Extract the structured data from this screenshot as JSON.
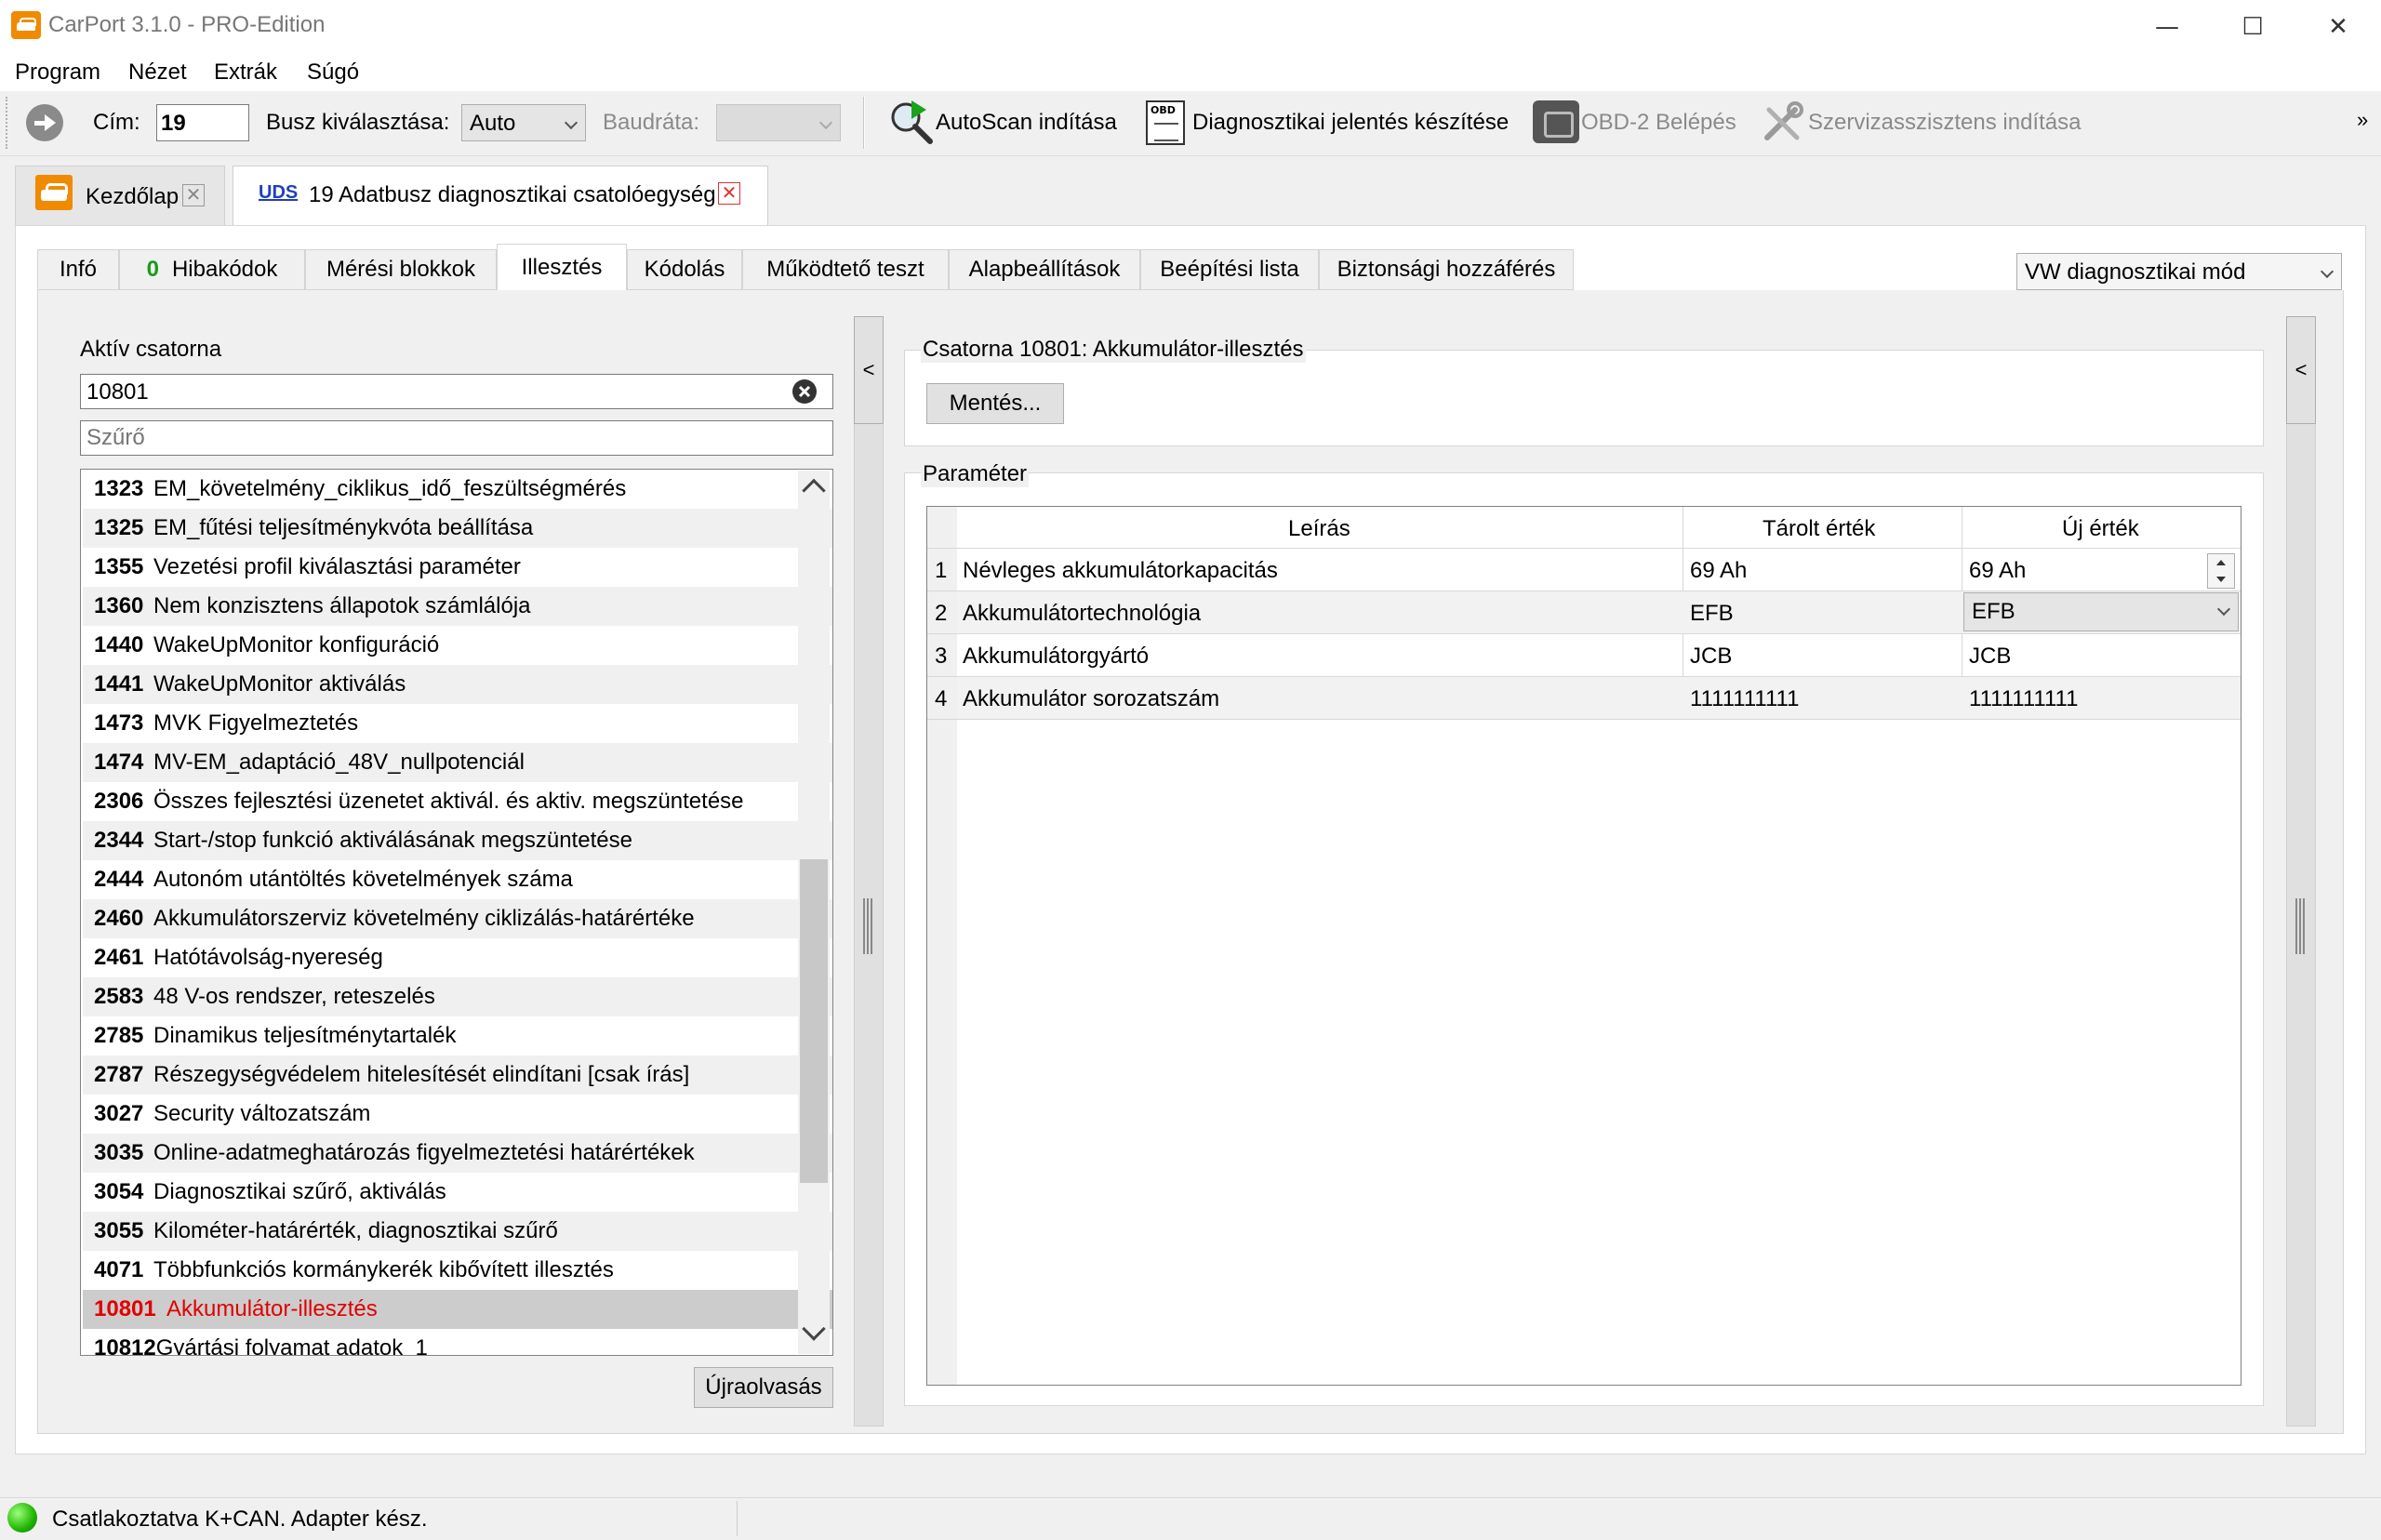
{
  "window": {
    "title": "CarPort 3.1.0 - PRO-Edition",
    "controls": [
      "—",
      "☐",
      "✕"
    ]
  },
  "menu": [
    "Program",
    "Nézet",
    "Extrák",
    "Súgó"
  ],
  "toolbar": {
    "address_label": "Cím:",
    "address_value": "19",
    "bus_label": "Busz kiválasztása:",
    "bus_value": "Auto",
    "baud_label": "Baudráta:",
    "baud_value": "",
    "autoscan": "AutoScan indítása",
    "report": "Diagnosztikai jelentés készítése",
    "obd": "OBD-2 Belépés",
    "service": "Szervizasszisztens indítása",
    "overflow": "»"
  },
  "doc_tabs": {
    "home": "Kezdőlap",
    "uds_badge": "UDS",
    "module": "19 Adatbusz diagnosztikai csatolóegység",
    "close": "✕"
  },
  "sub_tabs": {
    "info": "Infó",
    "fault_count": "0",
    "faults": "Hibakódok",
    "meas": "Mérési blokkok",
    "adapt": "Illesztés",
    "coding": "Kódolás",
    "actuator": "Működtető teszt",
    "basic": "Alapbeállítások",
    "install": "Beépítési lista",
    "security": "Biztonsági hozzáférés"
  },
  "mode_select": "VW diagnosztikai mód",
  "left": {
    "active_label": "Aktív csatorna",
    "channel_value": "10801",
    "filter_placeholder": "Szűrő",
    "reload": "Újraolvasás",
    "channels": [
      {
        "num": "1323",
        "name": "EM_követelmény_ciklikus_idő_feszültségmérés"
      },
      {
        "num": "1325",
        "name": "EM_fűtési teljesítménykvóta beállítása"
      },
      {
        "num": "1355",
        "name": "Vezetési profil kiválasztási paraméter"
      },
      {
        "num": "1360",
        "name": "Nem konzisztens állapotok számlálója"
      },
      {
        "num": "1440",
        "name": "WakeUpMonitor konfiguráció"
      },
      {
        "num": "1441",
        "name": "WakeUpMonitor aktiválás"
      },
      {
        "num": "1473",
        "name": "MVK Figyelmeztetés"
      },
      {
        "num": "1474",
        "name": "MV-EM_adaptáció_48V_nullpotenciál"
      },
      {
        "num": "2306",
        "name": "Összes fejlesztési üzenetet aktivál. és aktiv. megszüntetése"
      },
      {
        "num": "2344",
        "name": "Start-/stop funkció aktiválásának megszüntetése"
      },
      {
        "num": "2444",
        "name": "Autonóm utántöltés követelmények száma"
      },
      {
        "num": "2460",
        "name": "Akkumulátorszerviz követelmény ciklizálás-határértéke"
      },
      {
        "num": "2461",
        "name": "Hatótávolság-nyereség"
      },
      {
        "num": "2583",
        "name": "48 V-os rendszer, reteszelés"
      },
      {
        "num": "2785",
        "name": "Dinamikus teljesítménytartalék"
      },
      {
        "num": "2787",
        "name": "Részegységvédelem hitelesítését elindítani [csak írás]"
      },
      {
        "num": "3027",
        "name": "Security változatszám"
      },
      {
        "num": "3035",
        "name": "Online-adatmeghatározás figyelmeztetési határértékek"
      },
      {
        "num": "3054",
        "name": "Diagnosztikai szűrő, aktiválás"
      },
      {
        "num": "3055",
        "name": "Kilométer-határérték, diagnosztikai szűrő"
      },
      {
        "num": "4071",
        "name": "Többfunkciós kormánykerék kibővített illesztés"
      },
      {
        "num": "10801",
        "name": "Akkumulátor-illesztés"
      },
      {
        "num": "10812",
        "name": "Gyártási folyamat adatok_1"
      }
    ]
  },
  "right": {
    "channel_title": "Csatorna 10801: Akkumulátor-illesztés",
    "save": "Mentés...",
    "param_label": "Paraméter",
    "headers": {
      "desc": "Leírás",
      "stored": "Tárolt érték",
      "new": "Új érték"
    },
    "rows": [
      {
        "idx": "1",
        "desc": "Névleges akkumulátorkapacitás",
        "stored": "69 Ah",
        "new": "69 Ah"
      },
      {
        "idx": "2",
        "desc": "Akkumulátortechnológia",
        "stored": "EFB",
        "new": "EFB"
      },
      {
        "idx": "3",
        "desc": "Akkumulátorgyártó",
        "stored": "JCB",
        "new": "JCB"
      },
      {
        "idx": "4",
        "desc": "Akkumulátor sorozatszám",
        "stored": "1111111111",
        "new": "1111111111"
      }
    ]
  },
  "splitter_arrow": "<",
  "status": "Csatlakoztatva K+CAN. Adapter kész.",
  "colors": {
    "accent": "#f08a00",
    "selected_text": "#e00000",
    "fault_count": "#1a9a1a",
    "uds": "#1f3fbf",
    "led": "#1fb400"
  }
}
